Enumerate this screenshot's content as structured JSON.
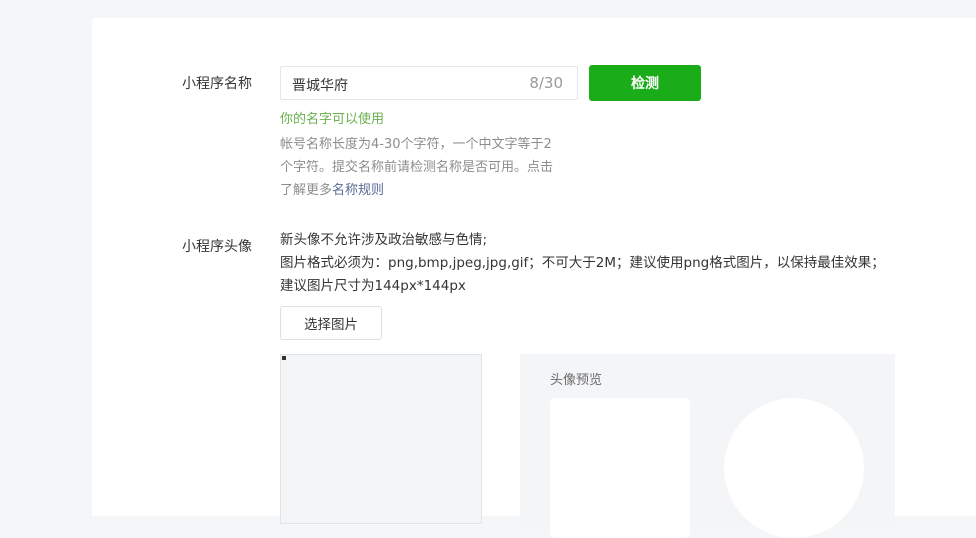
{
  "name_section": {
    "label": "小程序名称",
    "input_value": "晋城华府",
    "char_count": "8/30",
    "check_button": "检测",
    "status_message": "你的名字可以使用",
    "tip_line1": "帐号名称长度为4-30个字符，一个中文字等于2",
    "tip_line2": "个字符。提交名称前请检测名称是否可用。点击",
    "tip_line3_prefix": "了解更多",
    "tip_link": "名称规则"
  },
  "avatar_section": {
    "label": "小程序头像",
    "desc_line1": "新头像不允许涉及政治敏感与色情;",
    "desc_line2": "图片格式必须为：png,bmp,jpeg,jpg,gif；不可大于2M；建议使用png格式图片，以保持最佳效果；建议图片尺寸为144px*144px",
    "choose_button": "选择图片",
    "preview_title": "头像预览"
  },
  "colors": {
    "primary_green": "#1aad19",
    "success_text": "#6ab04c",
    "link": "#576b95"
  }
}
